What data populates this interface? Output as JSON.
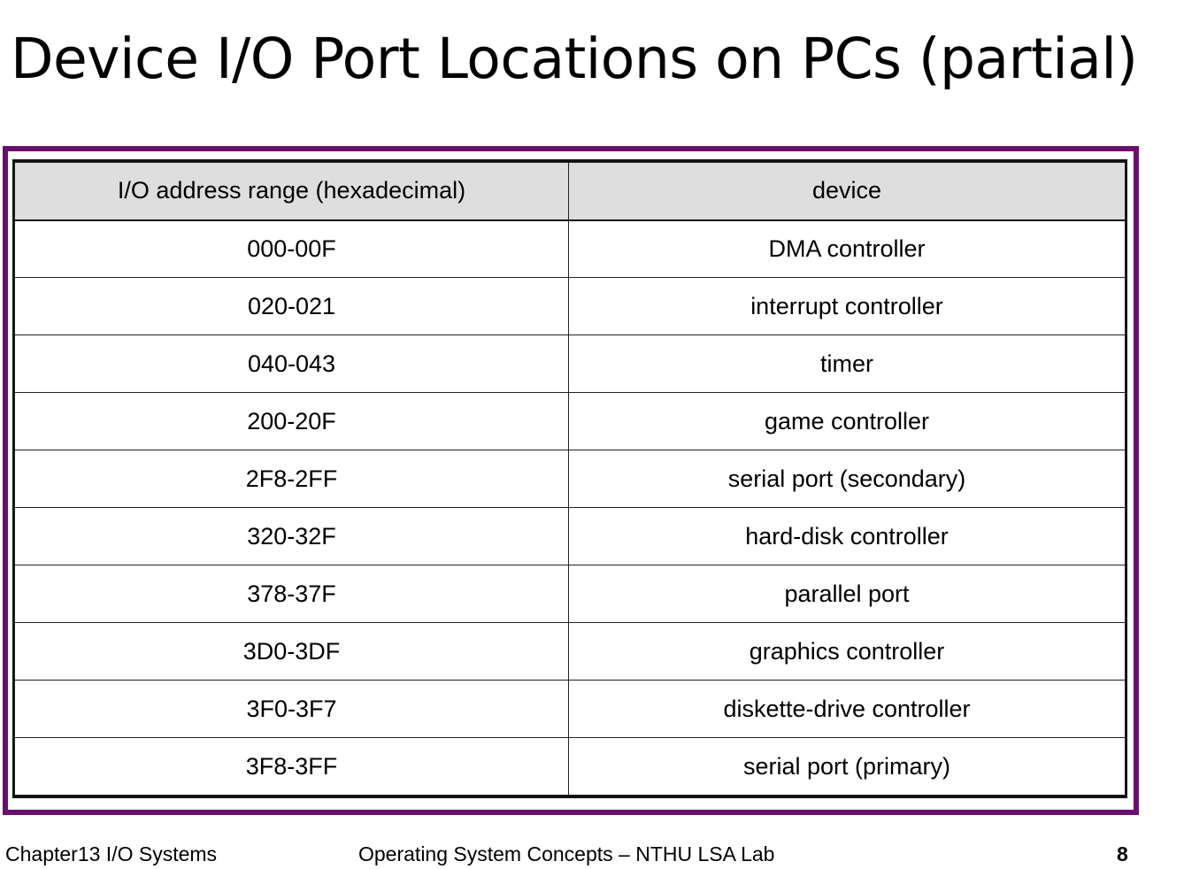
{
  "title": "Device I/O Port Locations on PCs (partial)",
  "table": {
    "headers": [
      "I/O address range (hexadecimal)",
      "device"
    ],
    "rows": [
      [
        "000-00F",
        "DMA controller"
      ],
      [
        "020-021",
        "interrupt controller"
      ],
      [
        "040-043",
        "timer"
      ],
      [
        "200-20F",
        "game controller"
      ],
      [
        "2F8-2FF",
        "serial port (secondary)"
      ],
      [
        "320-32F",
        "hard-disk controller"
      ],
      [
        "378-37F",
        "parallel port"
      ],
      [
        "3D0-3DF",
        "graphics controller"
      ],
      [
        "3F0-3F7",
        "diskette-drive controller"
      ],
      [
        "3F8-3FF",
        "serial port (primary)"
      ]
    ]
  },
  "footer": {
    "chapter": "Chapter13  I/O Systems",
    "course": "Operating System Concepts – NTHU LSA Lab",
    "page": "8"
  },
  "colors": {
    "frame": "#6a0f6e",
    "header_bg": "#dedede"
  }
}
